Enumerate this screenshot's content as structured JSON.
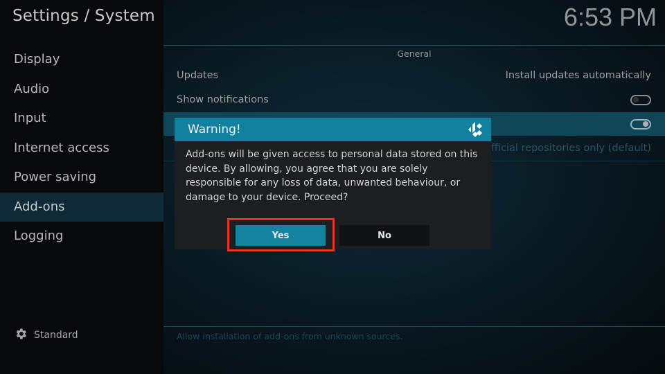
{
  "header": {
    "title": "Settings / System",
    "clock": "6:53 PM"
  },
  "sidebar": {
    "items": [
      {
        "label": "Display",
        "active": false
      },
      {
        "label": "Audio",
        "active": false
      },
      {
        "label": "Input",
        "active": false
      },
      {
        "label": "Internet access",
        "active": false
      },
      {
        "label": "Power saving",
        "active": false
      },
      {
        "label": "Add-ons",
        "active": true
      },
      {
        "label": "Logging",
        "active": false
      }
    ],
    "profile": {
      "icon": "gear-icon",
      "label": "Standard"
    }
  },
  "main": {
    "section_header": "General",
    "settings": [
      {
        "label": "Updates",
        "value": "Install updates automatically",
        "type": "text"
      },
      {
        "label": "Show notifications",
        "value": "off",
        "type": "toggle"
      },
      {
        "label": "",
        "value": "on",
        "type": "toggle",
        "focused": true
      },
      {
        "label": "",
        "value": "Official repositories only (default)",
        "type": "text"
      }
    ],
    "help_text": "Allow installation of add-ons from unknown sources."
  },
  "dialog": {
    "title": "Warning!",
    "icon": "kodi-logo-icon",
    "message": "Add-ons will be given access to personal data stored on this device. By allowing, you agree that you are solely responsible for any loss of data, unwanted behaviour, or damage to your device. Proceed?",
    "buttons": {
      "yes": "Yes",
      "no": "No"
    },
    "highlighted_button": "yes"
  },
  "colors": {
    "accent": "#12809f",
    "highlight_annotation": "#e8321c",
    "focused_row": "#0f4658"
  }
}
